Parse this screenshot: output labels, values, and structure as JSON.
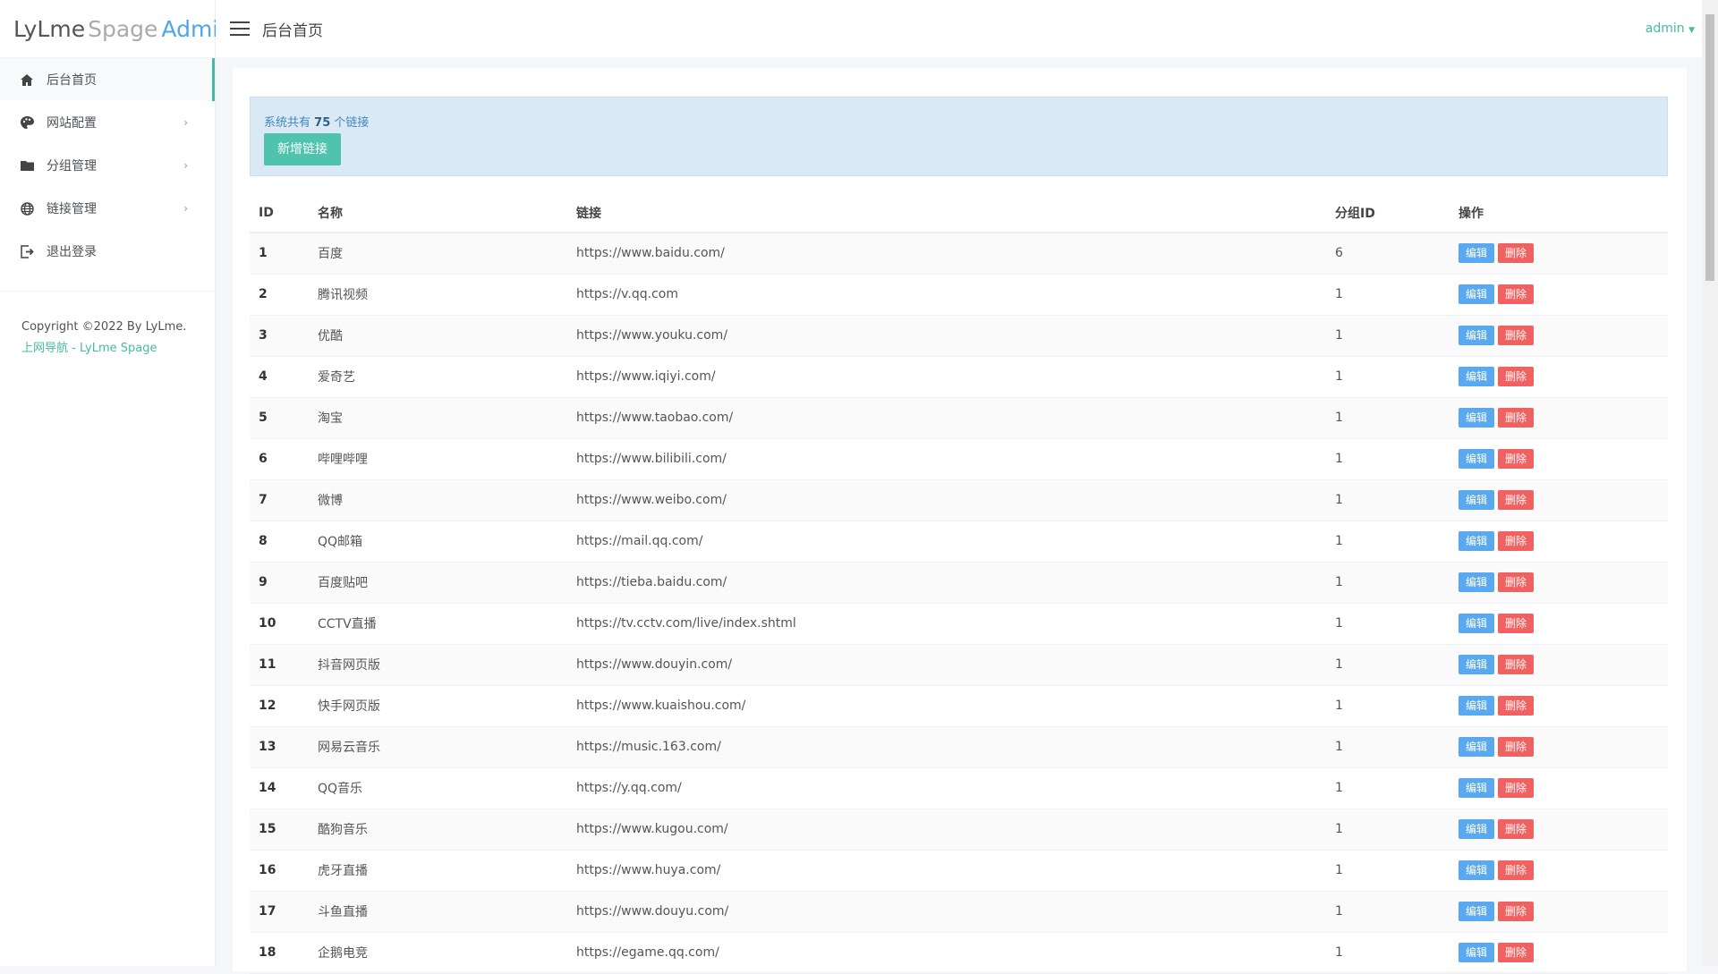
{
  "logo": {
    "part1": "LyLme",
    "part2": "Spage",
    "part3": "Admin"
  },
  "sidebar": {
    "items": [
      {
        "label": "后台首页",
        "icon": "home-icon"
      },
      {
        "label": "网站配置",
        "icon": "palette-icon"
      },
      {
        "label": "分组管理",
        "icon": "folder-icon"
      },
      {
        "label": "链接管理",
        "icon": "globe-icon"
      },
      {
        "label": "退出登录",
        "icon": "logout-icon"
      }
    ],
    "copyright": "Copyright ©2022 By LyLme.",
    "footer_link": "上网导航 - LyLme Spage"
  },
  "header": {
    "title": "后台首页",
    "user": "admin"
  },
  "alert": {
    "prefix": "系统共有",
    "count": "75",
    "suffix": "个链接",
    "add_button": "新增链接"
  },
  "table": {
    "headers": [
      "ID",
      "名称",
      "链接",
      "分组ID",
      "操作"
    ],
    "edit_label": "编辑",
    "delete_label": "删除",
    "rows": [
      [
        "1",
        "百度",
        "https://www.baidu.com/",
        "6"
      ],
      [
        "2",
        "腾讯视频",
        "https://v.qq.com",
        "1"
      ],
      [
        "3",
        "优酷",
        "https://www.youku.com/",
        "1"
      ],
      [
        "4",
        "爱奇艺",
        "https://www.iqiyi.com/",
        "1"
      ],
      [
        "5",
        "淘宝",
        "https://www.taobao.com/",
        "1"
      ],
      [
        "6",
        "哔哩哔哩",
        "https://www.bilibili.com/",
        "1"
      ],
      [
        "7",
        "微博",
        "https://www.weibo.com/",
        "1"
      ],
      [
        "8",
        "QQ邮箱",
        "https://mail.qq.com/",
        "1"
      ],
      [
        "9",
        "百度贴吧",
        "https://tieba.baidu.com/",
        "1"
      ],
      [
        "10",
        "CCTV直播",
        "https://tv.cctv.com/live/index.shtml",
        "1"
      ],
      [
        "11",
        "抖音网页版",
        "https://www.douyin.com/",
        "1"
      ],
      [
        "12",
        "快手网页版",
        "https://www.kuaishou.com/",
        "1"
      ],
      [
        "13",
        "网易云音乐",
        "https://music.163.com/",
        "1"
      ],
      [
        "14",
        "QQ音乐",
        "https://y.qq.com/",
        "1"
      ],
      [
        "15",
        "酷狗音乐",
        "https://www.kugou.com/",
        "1"
      ],
      [
        "16",
        "虎牙直播",
        "https://www.huya.com/",
        "1"
      ],
      [
        "17",
        "斗鱼直播",
        "https://www.douyu.com/",
        "1"
      ],
      [
        "18",
        "企鹅电竞",
        "https://egame.qq.com/",
        "1"
      ]
    ]
  },
  "colors": {
    "accent": "#48b9a5",
    "edit": "#5aa8ef",
    "delete": "#f06161",
    "alert_bg": "#dbe9f5"
  }
}
